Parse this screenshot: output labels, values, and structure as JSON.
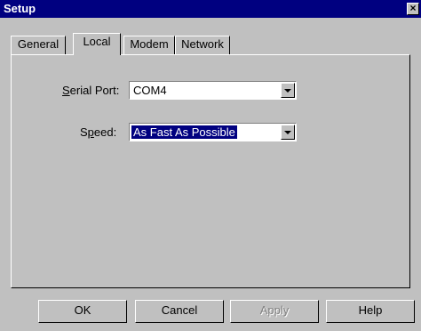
{
  "window": {
    "title": "Setup",
    "close_label": "×"
  },
  "tabs": [
    {
      "label": "General"
    },
    {
      "label": "Local"
    },
    {
      "label": "Modem"
    },
    {
      "label": "Network"
    }
  ],
  "active_tab": "Local",
  "fields": {
    "serial_port": {
      "label_prefix": "S",
      "label_rest": "erial Port:",
      "value": "COM4"
    },
    "speed": {
      "label_prefix": "S",
      "label_u": "p",
      "label_rest": "eed:",
      "value": "As Fast As Possible"
    }
  },
  "buttons": {
    "ok": "OK",
    "cancel": "Cancel",
    "apply": "Apply",
    "help": "Help"
  }
}
